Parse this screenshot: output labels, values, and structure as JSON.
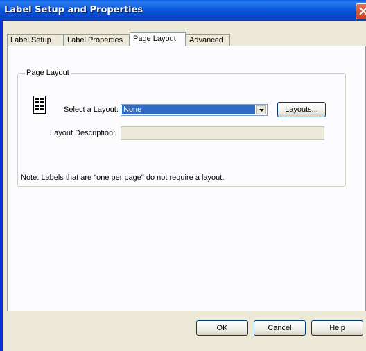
{
  "window": {
    "title": "Label Setup and Properties"
  },
  "tabs": [
    {
      "label": "Label Setup",
      "active": false
    },
    {
      "label": "Label Properties",
      "active": false
    },
    {
      "label": "Page Layout",
      "active": true
    },
    {
      "label": "Advanced",
      "active": false
    }
  ],
  "page_layout": {
    "group_title": "Page Layout",
    "icon": "layout-grid-icon",
    "select_label": "Select a Layout:",
    "select_value": "None",
    "layouts_button": "Layouts...",
    "description_label": "Layout Description:",
    "description_value": "",
    "note": "Note: Labels that are \"one per page\" do not require a layout."
  },
  "footer": {
    "ok": "OK",
    "cancel": "Cancel",
    "help": "Help"
  },
  "colors": {
    "titlebar": "#0a58dd",
    "dialog_bg": "#ece9d8",
    "selection": "#316ac5"
  }
}
